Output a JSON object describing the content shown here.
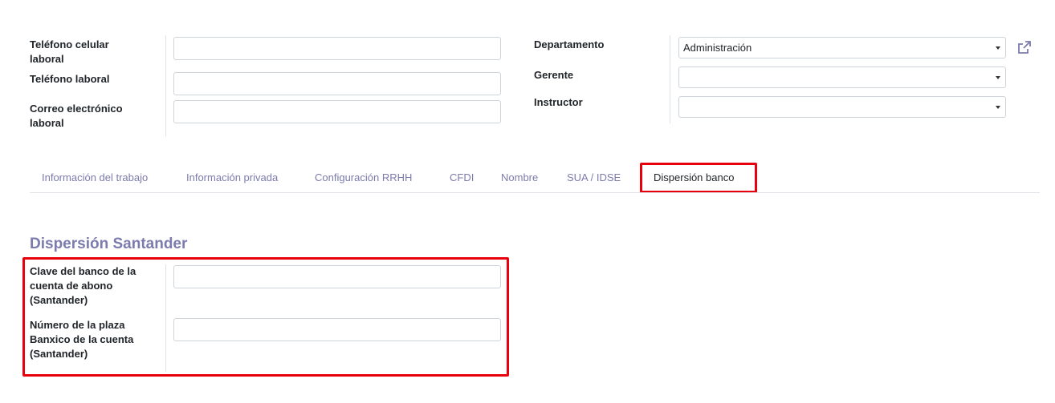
{
  "top_form": {
    "left_fields": [
      {
        "label_lines": [
          "Teléfono celular",
          "laboral"
        ],
        "value": ""
      },
      {
        "label_lines": [
          "Teléfono laboral"
        ],
        "value": ""
      },
      {
        "label_lines": [
          "Correo electrónico",
          "laboral"
        ],
        "value": ""
      }
    ],
    "right_fields": [
      {
        "label": "Departamento",
        "value": "Administración"
      },
      {
        "label": "Gerente",
        "value": ""
      },
      {
        "label": "Instructor",
        "value": ""
      }
    ]
  },
  "tabs": [
    {
      "label": "Información del trabajo"
    },
    {
      "label": "Información privada"
    },
    {
      "label": "Configuración RRHH"
    },
    {
      "label": "CFDI"
    },
    {
      "label": "Nombre"
    },
    {
      "label": "SUA / IDSE"
    },
    {
      "label": "Dispersión banco",
      "active": true
    }
  ],
  "section": {
    "title": "Dispersión Santander",
    "fields": [
      {
        "label_lines": [
          "Clave del banco de la",
          "cuenta de abono",
          "(Santander)"
        ],
        "value": ""
      },
      {
        "label_lines": [
          "Número de la plaza",
          "Banxico de la cuenta",
          "(Santander)"
        ],
        "value": ""
      }
    ]
  },
  "colors": {
    "highlight": "#e8000d",
    "tab_inactive": "#7c7bad",
    "section_title": "#7c7bad"
  },
  "icons": {
    "external_link": "external-link-icon"
  }
}
